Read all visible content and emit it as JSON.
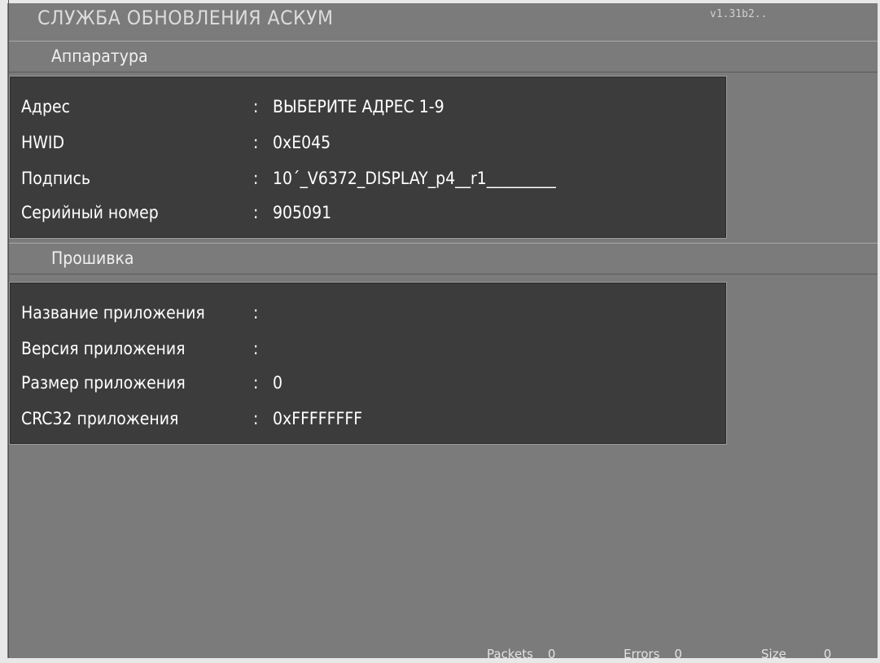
{
  "app": {
    "title": "СЛУЖБА ОБНОВЛЕНИЯ АСКУМ",
    "version": "v1.31b2.."
  },
  "hardware": {
    "header": "Аппаратура",
    "rows": [
      {
        "key": "Адрес",
        "value": "ВЫБЕРИТЕ АДРЕС 1-9"
      },
      {
        "key": "HWID",
        "value": "0xE045"
      },
      {
        "key": "Подпись",
        "value": "10´_V6372_DISPLAY_p4__r1_________"
      },
      {
        "key": "Серийный номер",
        "value": "905091"
      }
    ]
  },
  "firmware": {
    "header": "Прошивка",
    "rows": [
      {
        "key": "Название приложения",
        "value": ""
      },
      {
        "key": "Версия приложения",
        "value": ""
      },
      {
        "key": "Размер приложения",
        "value": "0"
      },
      {
        "key": "CRC32 приложения",
        "value": "0xFFFFFFFF"
      }
    ]
  },
  "status": {
    "packets_label": "Packets",
    "packets_value": "0",
    "errors_label": "Errors",
    "errors_value": "0",
    "size_label": "Size",
    "size_value": "0"
  },
  "separator": ":"
}
